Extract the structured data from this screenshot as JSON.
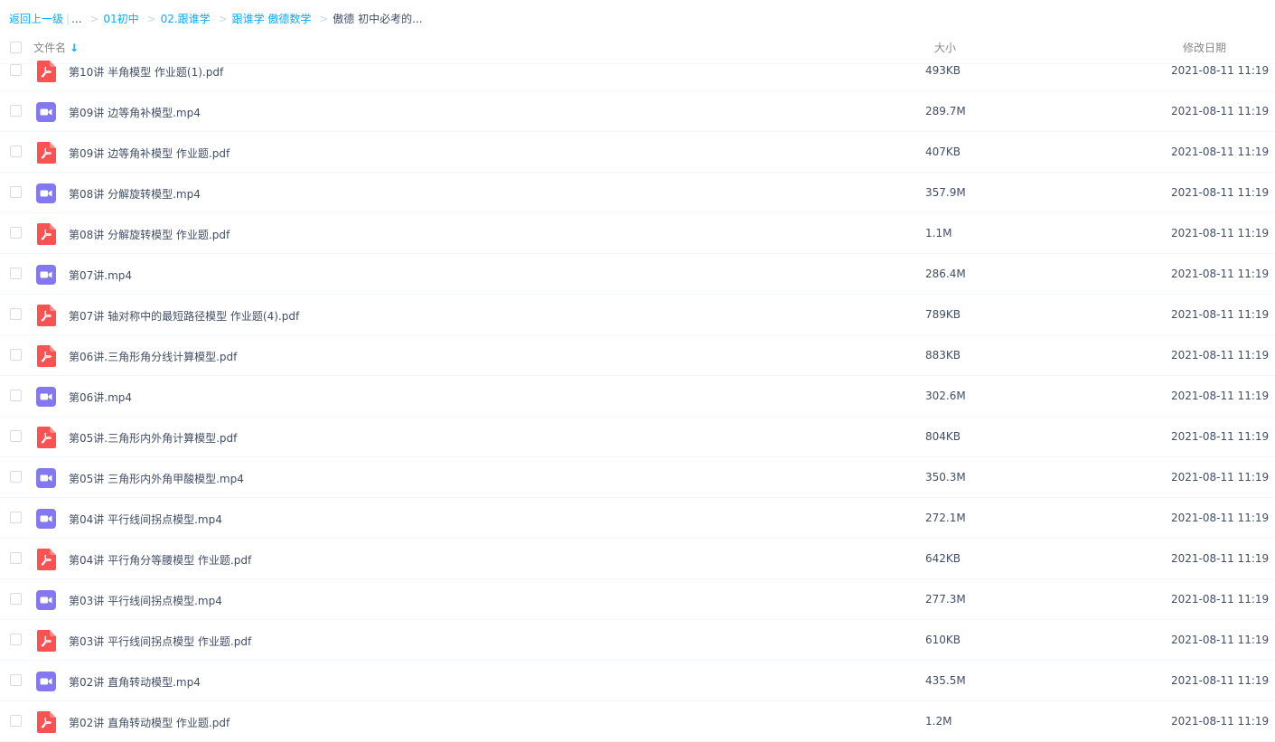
{
  "breadcrumb": {
    "back_label": "返回上一级",
    "ellipsis": "...",
    "items": [
      "01初中",
      "02.跟谁学",
      "跟谁学 傲德数学"
    ],
    "current": "傲德 初中必考的..."
  },
  "header": {
    "name_label": "文件名",
    "sort_arrow": "↓",
    "size_label": "大小",
    "date_label": "修改日期"
  },
  "colors": {
    "pdf": "#fa5151",
    "video": "#8378f0",
    "accent": "#09aaff"
  },
  "files": [
    {
      "name": "第10讲 半角模型 作业题(1).pdf",
      "size": "493KB",
      "date": "2021-08-11 11:19",
      "type": "pdf"
    },
    {
      "name": "第09讲 边等角补模型.mp4",
      "size": "289.7M",
      "date": "2021-08-11 11:19",
      "type": "video"
    },
    {
      "name": "第09讲 边等角补模型 作业题.pdf",
      "size": "407KB",
      "date": "2021-08-11 11:19",
      "type": "pdf"
    },
    {
      "name": "第08讲 分解旋转模型.mp4",
      "size": "357.9M",
      "date": "2021-08-11 11:19",
      "type": "video"
    },
    {
      "name": "第08讲 分解旋转模型 作业题.pdf",
      "size": "1.1M",
      "date": "2021-08-11 11:19",
      "type": "pdf"
    },
    {
      "name": "第07讲.mp4",
      "size": "286.4M",
      "date": "2021-08-11 11:19",
      "type": "video"
    },
    {
      "name": "第07讲 轴对称中的最短路径模型 作业题(4).pdf",
      "size": "789KB",
      "date": "2021-08-11 11:19",
      "type": "pdf"
    },
    {
      "name": "第06讲.三角形角分线计算模型.pdf",
      "size": "883KB",
      "date": "2021-08-11 11:19",
      "type": "pdf"
    },
    {
      "name": "第06讲.mp4",
      "size": "302.6M",
      "date": "2021-08-11 11:19",
      "type": "video"
    },
    {
      "name": "第05讲.三角形内外角计算模型.pdf",
      "size": "804KB",
      "date": "2021-08-11 11:19",
      "type": "pdf"
    },
    {
      "name": "第05讲 三角形内外角甲酸模型.mp4",
      "size": "350.3M",
      "date": "2021-08-11 11:19",
      "type": "video"
    },
    {
      "name": "第04讲 平行线间拐点模型.mp4",
      "size": "272.1M",
      "date": "2021-08-11 11:19",
      "type": "video"
    },
    {
      "name": "第04讲 平行角分等腰模型 作业题.pdf",
      "size": "642KB",
      "date": "2021-08-11 11:19",
      "type": "pdf"
    },
    {
      "name": "第03讲 平行线间拐点模型.mp4",
      "size": "277.3M",
      "date": "2021-08-11 11:19",
      "type": "video"
    },
    {
      "name": "第03讲 平行线间拐点模型 作业题.pdf",
      "size": "610KB",
      "date": "2021-08-11 11:19",
      "type": "pdf"
    },
    {
      "name": "第02讲 直角转动模型.mp4",
      "size": "435.5M",
      "date": "2021-08-11 11:19",
      "type": "video"
    },
    {
      "name": "第02讲 直角转动模型 作业题.pdf",
      "size": "1.2M",
      "date": "2021-08-11 11:19",
      "type": "pdf"
    }
  ]
}
